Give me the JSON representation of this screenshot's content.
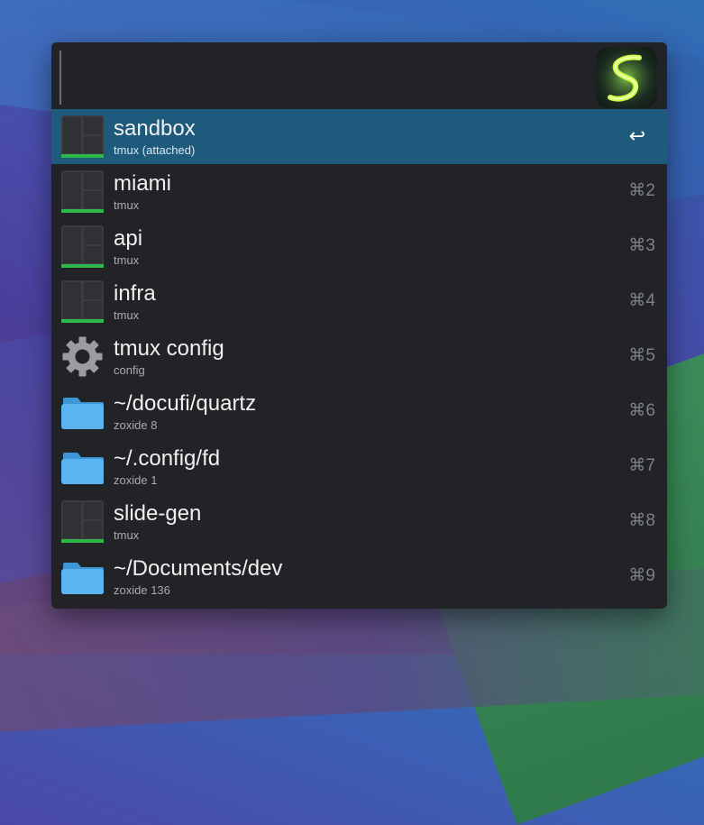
{
  "search": {
    "value": "",
    "placeholder": ""
  },
  "app_logo": {
    "icon": "app-logo-icon"
  },
  "items": [
    {
      "title": "sandbox",
      "subtitle": "tmux (attached)",
      "shortcut": "↩",
      "icon": "tmux-session-icon",
      "selected": true
    },
    {
      "title": "miami",
      "subtitle": "tmux",
      "shortcut": "⌘2",
      "icon": "tmux-session-icon"
    },
    {
      "title": "api",
      "subtitle": "tmux",
      "shortcut": "⌘3",
      "icon": "tmux-session-icon"
    },
    {
      "title": "infra",
      "subtitle": "tmux",
      "shortcut": "⌘4",
      "icon": "tmux-session-icon"
    },
    {
      "title": "tmux config",
      "subtitle": "config",
      "shortcut": "⌘5",
      "icon": "gear-icon"
    },
    {
      "title": "~/docufi/quartz",
      "subtitle": "zoxide 8",
      "shortcut": "⌘6",
      "icon": "folder-icon"
    },
    {
      "title": "~/.config/fd",
      "subtitle": "zoxide 1",
      "shortcut": "⌘7",
      "icon": "folder-icon"
    },
    {
      "title": "slide-gen",
      "subtitle": "tmux",
      "shortcut": "⌘8",
      "icon": "tmux-session-icon"
    },
    {
      "title": "~/Documents/dev",
      "subtitle": "zoxide 136",
      "shortcut": "⌘9",
      "icon": "folder-icon"
    }
  ],
  "colors": {
    "selected_row": "#1e5a7c",
    "panel_bg": "#222326",
    "tmux_accent": "#2fb84a",
    "folder_blue": "#5ab4f0"
  }
}
